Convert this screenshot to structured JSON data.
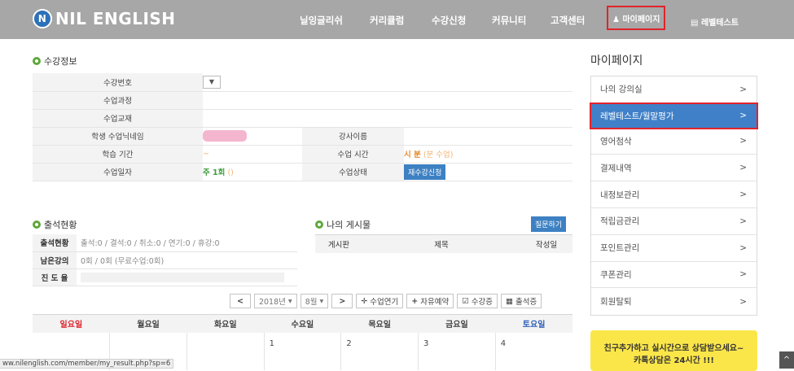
{
  "header": {
    "logo_text": "NIL ENGLISH",
    "logo_mark": "N",
    "nav": [
      "닐잉글리쉬",
      "커리큘럼",
      "수강신청",
      "커뮤니티",
      "고객센터"
    ],
    "mypage": "마이페이지",
    "mypage_icon": "user-icon",
    "leveltest": "레벨테스트",
    "leveltest_icon": "bar-chart-icon"
  },
  "course_info": {
    "title": "수강정보",
    "labels": {
      "course_no": "수강번호",
      "course": "수업과정",
      "textbook": "수업교재",
      "nickname": "학생 수업닉네임",
      "teacher": "강사이름",
      "period": "학습 기간",
      "class_time": "수업 시간",
      "class_day": "수업일자",
      "status": "수업상태"
    },
    "period_value": "~",
    "class_time_value": "시 분",
    "class_time_suffix": "(분 수업)",
    "class_day_value": "주 1회",
    "class_day_suffix": "()",
    "status_button": "재수강신청",
    "select_glyph": "▼"
  },
  "attendance": {
    "title": "출석현황",
    "rows": [
      {
        "label": "출석현황",
        "value": "출석:0 / 결석:0 / 취소:0 / 연기:0 / 휴강:0"
      },
      {
        "label": "남은강의",
        "value": "0회 / 0회 (무료수업:0회)"
      },
      {
        "label": "진 도 율",
        "value": ""
      }
    ]
  },
  "posts": {
    "title": "나의 게시물",
    "ask_button": "질문하기",
    "headers": [
      "게시판",
      "제목",
      "작성일"
    ]
  },
  "toolbar": {
    "prev": "<",
    "year": "2018년",
    "month": "8월",
    "next": ">",
    "postpone": "수업연기",
    "free_booking": "자유예약",
    "certificate": "수강증",
    "attendance_cert": "출석증",
    "icons": {
      "postpone": "move-icon",
      "free_booking": "plus-icon",
      "certificate": "check-icon",
      "attendance_cert": "calendar-icon"
    }
  },
  "calendar": {
    "days": [
      "일요일",
      "월요일",
      "화요일",
      "수요일",
      "목요일",
      "금요일",
      "토요일"
    ],
    "dates": [
      "",
      "",
      "",
      "1",
      "2",
      "3",
      "4"
    ],
    "colors": {
      "sunday": "#e0232b",
      "saturday": "#2d5fb8"
    }
  },
  "sidebar": {
    "title": "마이페이지",
    "items": [
      "나의 강의실",
      "레벨테스트/월말평가",
      "영어첨삭",
      "결제내역",
      "내정보관리",
      "적립금관리",
      "포인트관리",
      "쿠폰관리",
      "회원탈퇴"
    ],
    "active_index": 1,
    "chevron": ">"
  },
  "promo": {
    "line1": "친구추가하고 실시간으로 상담받으세요~",
    "line2": "카톡상담은 24시간 !!!"
  },
  "statusbar": {
    "url": "ww.nilenglish.com/member/my_result.php?sp=6"
  },
  "scroll_top_glyph": "^"
}
